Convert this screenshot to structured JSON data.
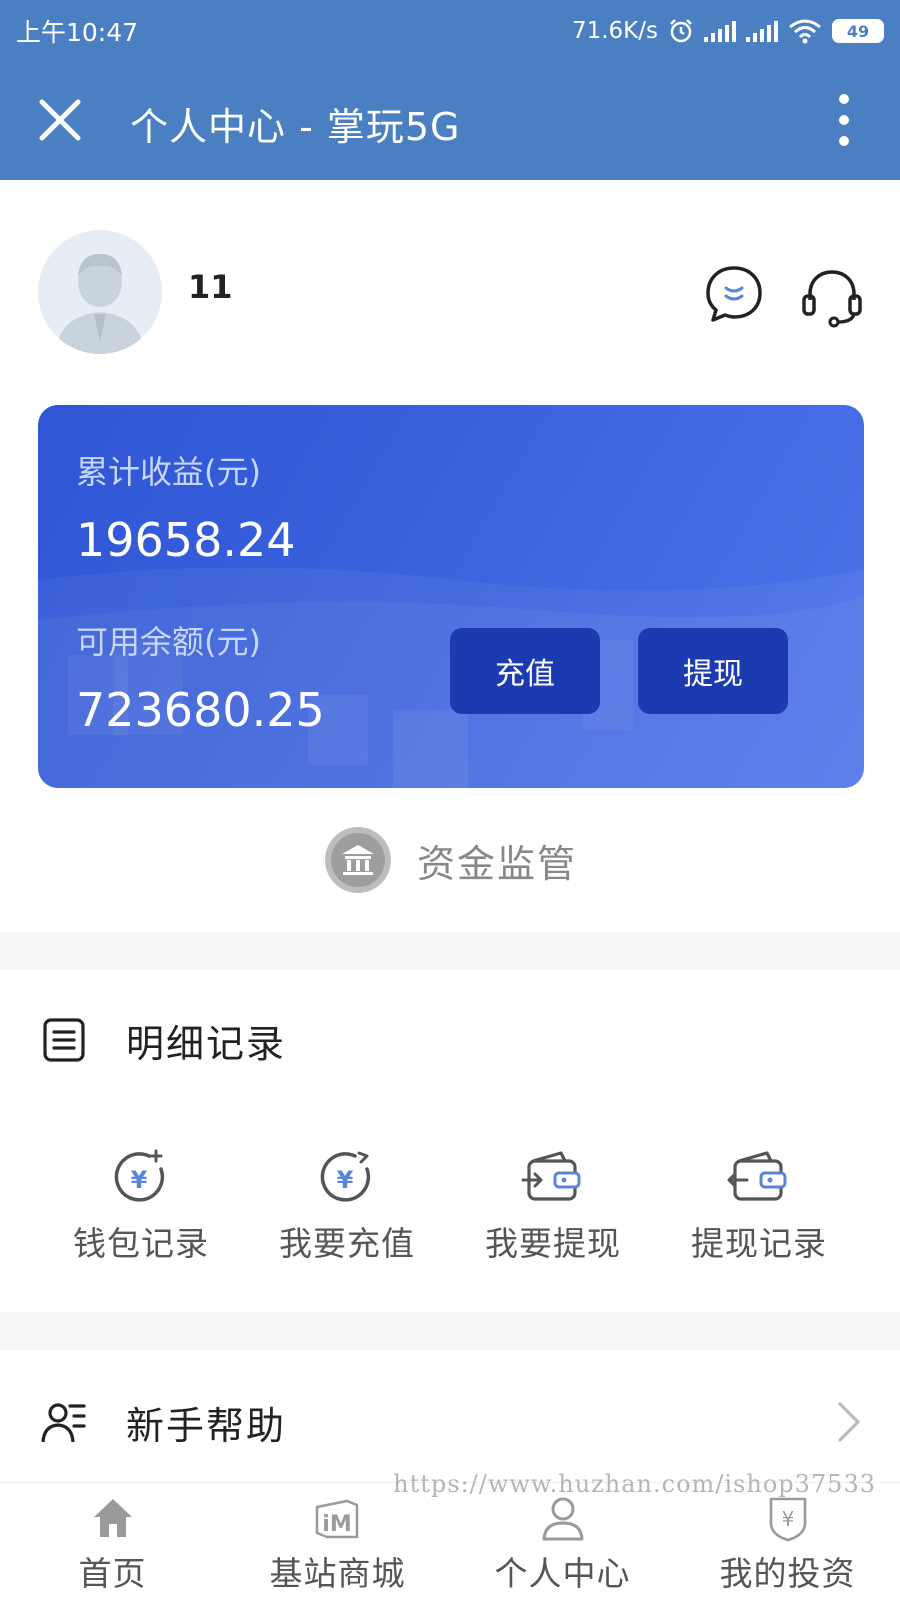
{
  "status_bar": {
    "time": "上午10:47",
    "net_speed": "71.6K/s",
    "battery": "49"
  },
  "header": {
    "title": "个人中心 - 掌玩5G"
  },
  "profile": {
    "username": "11"
  },
  "balance_card": {
    "total_earnings_label": "累计收益(元)",
    "total_earnings_value": "19658.24",
    "available_balance_label": "可用余额(元)",
    "available_balance_value": "723680.25",
    "recharge_label": "充值",
    "withdraw_label": "提现"
  },
  "fund_supervision": {
    "label": "资金监管"
  },
  "details": {
    "title": "明细记录",
    "actions": [
      {
        "label": "钱包记录",
        "icon": "wallet-record-icon"
      },
      {
        "label": "我要充值",
        "icon": "recharge-icon"
      },
      {
        "label": "我要提现",
        "icon": "withdraw-icon"
      },
      {
        "label": "提现记录",
        "icon": "withdraw-record-icon"
      }
    ]
  },
  "help": {
    "title": "新手帮助"
  },
  "watermark": "https://www.huzhan.com/ishop37533",
  "bottom_nav": [
    {
      "label": "首页",
      "icon": "home-icon"
    },
    {
      "label": "基站商城",
      "icon": "mall-icon"
    },
    {
      "label": "个人中心",
      "icon": "user-icon"
    },
    {
      "label": "我的投资",
      "icon": "investment-icon"
    }
  ],
  "colors": {
    "header_bg": "#4a7fc1",
    "card_bg": "#3a62dc",
    "card_button": "#1d3bb0",
    "icon_accent": "#5b86d8"
  }
}
